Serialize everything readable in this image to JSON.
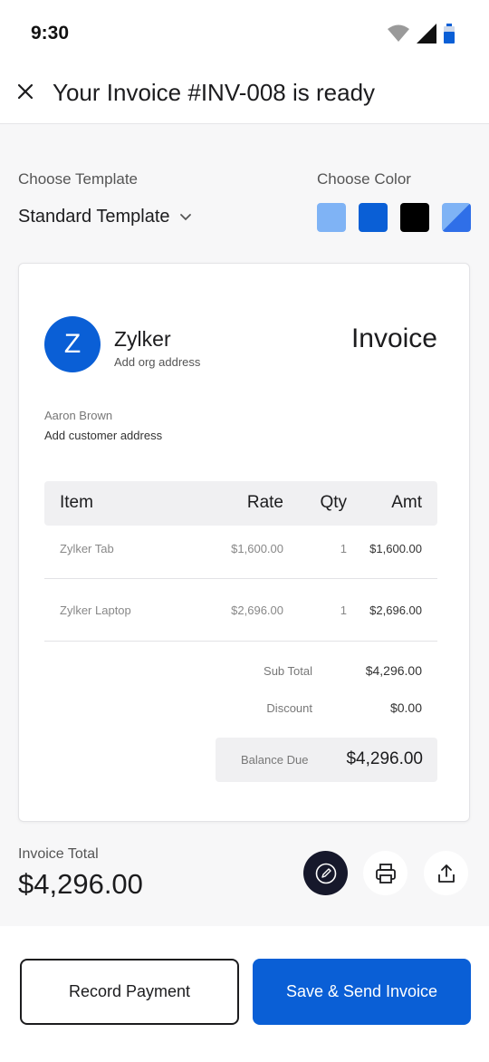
{
  "status": {
    "time": "9:30"
  },
  "header": {
    "title": "Your Invoice #INV-008 is ready"
  },
  "template": {
    "label": "Choose Template",
    "selected": "Standard Template"
  },
  "color": {
    "label": "Choose Color",
    "swatches": [
      "#7fb3f5",
      "#0a5fd6",
      "#000000",
      "#3d7ef5"
    ]
  },
  "invoice": {
    "logo_letter": "Z",
    "org_name": "Zylker",
    "org_address": "Add org address",
    "title": "Invoice",
    "customer_name": "Aaron Brown",
    "customer_address": "Add customer address",
    "columns": {
      "item": "Item",
      "rate": "Rate",
      "qty": "Qty",
      "amt": "Amt"
    },
    "rows": [
      {
        "item": "Zylker Tab",
        "rate": "$1,600.00",
        "qty": "1",
        "amt": "$1,600.00"
      },
      {
        "item": "Zylker Laptop",
        "rate": "$2,696.00",
        "qty": "1",
        "amt": "$2,696.00"
      }
    ],
    "sub_total_label": "Sub Total",
    "sub_total": "$4,296.00",
    "discount_label": "Discount",
    "discount": "$0.00",
    "balance_due_label": "Balance Due",
    "balance_due": "$4,296.00"
  },
  "summary": {
    "label": "Invoice Total",
    "value": "$4,296.00"
  },
  "actions": {
    "record_payment": "Record Payment",
    "save_send": "Save & Send Invoice"
  },
  "colors": {
    "accent": "#0a5fd6",
    "dark": "#16182b"
  }
}
